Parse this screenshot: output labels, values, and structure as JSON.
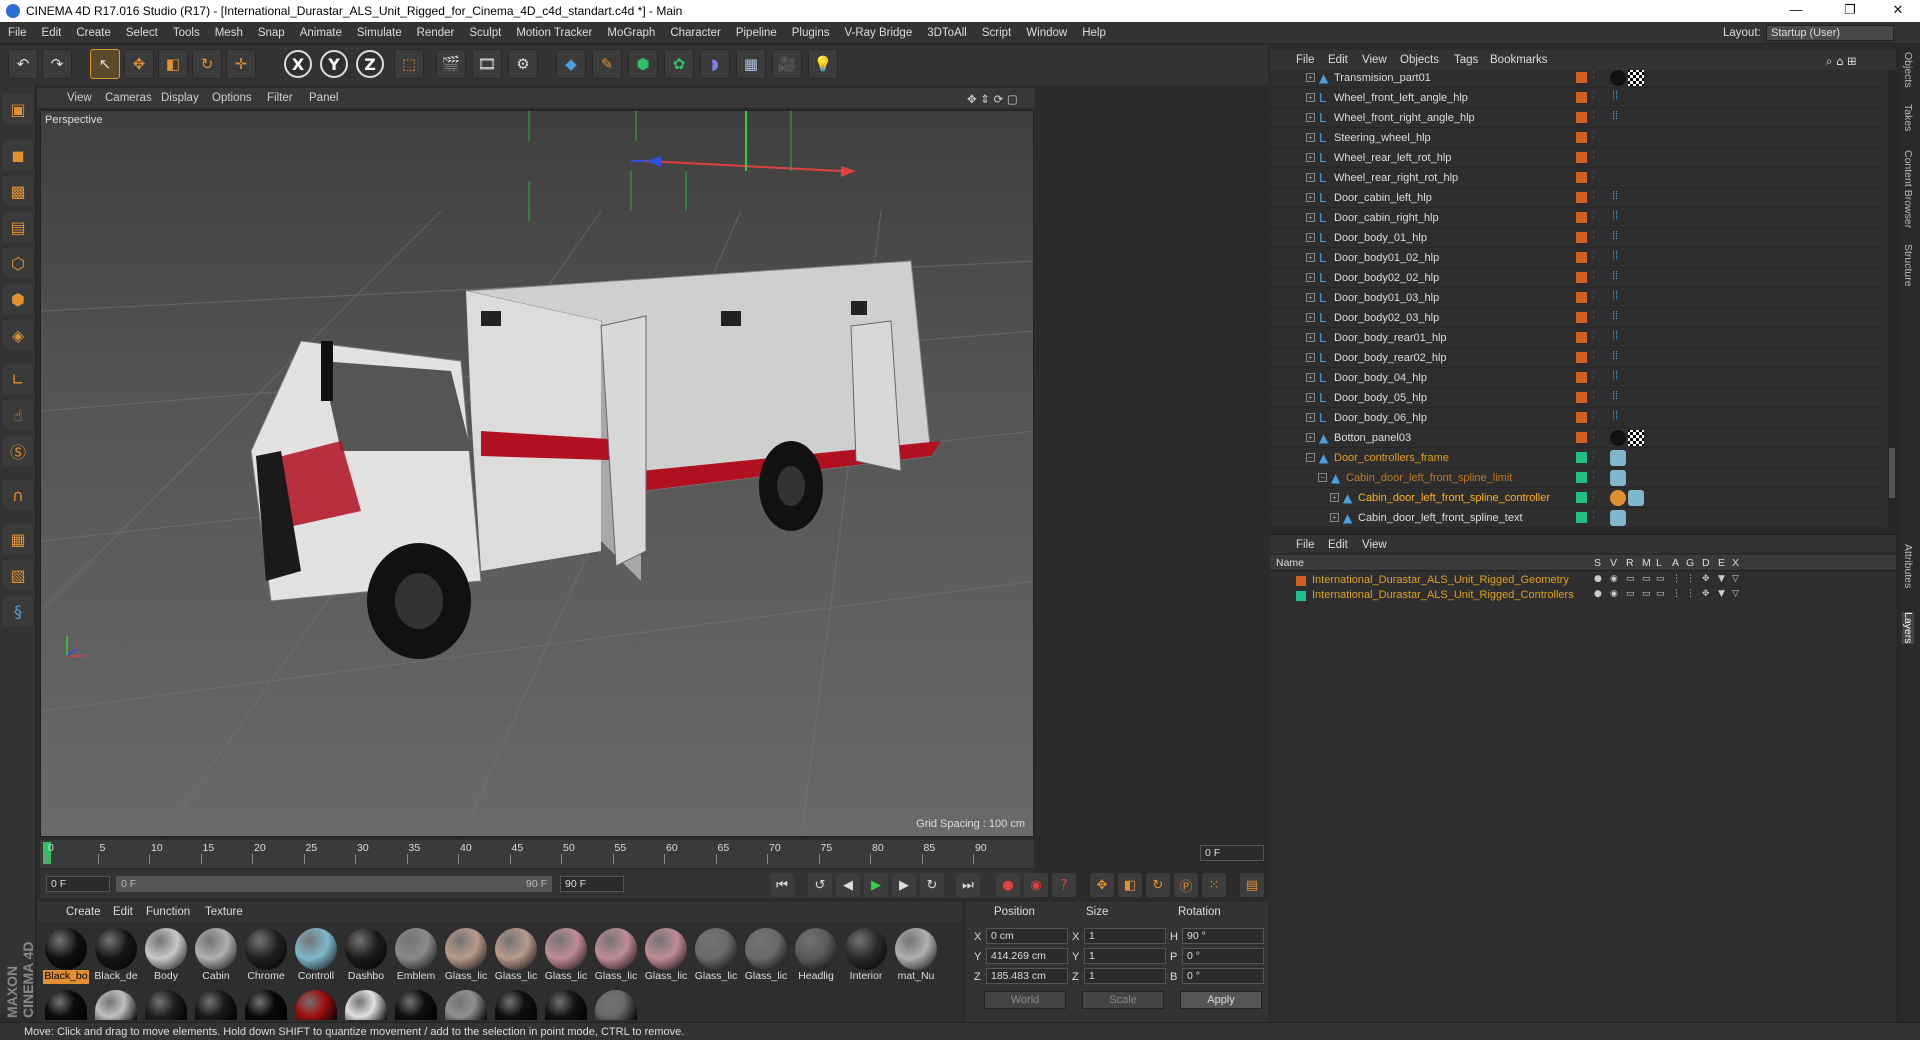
{
  "window": {
    "title": "CINEMA 4D R17.016 Studio (R17) - [International_Durastar_ALS_Unit_Rigged_for_Cinema_4D_c4d_standart.c4d *] - Main",
    "controls": [
      "—",
      "❐",
      "✕"
    ]
  },
  "menubar": {
    "items": [
      "File",
      "Edit",
      "Create",
      "Select",
      "Tools",
      "Mesh",
      "Snap",
      "Animate",
      "Simulate",
      "Render",
      "Sculpt",
      "Motion Tracker",
      "MoGraph",
      "Character",
      "Pipeline",
      "Plugins",
      "V-Ray Bridge",
      "3DToAll",
      "Script",
      "Window",
      "Help"
    ],
    "layout_label": "Layout:",
    "layout_value": "Startup (User)"
  },
  "viewport": {
    "menu": [
      "View",
      "Cameras",
      "Display",
      "Options",
      "Filter",
      "Panel"
    ],
    "camera_label": "Perspective",
    "grid_spacing": "Grid Spacing : 100 cm"
  },
  "timeline": {
    "ticks": [
      "0",
      "5",
      "10",
      "15",
      "20",
      "25",
      "30",
      "35",
      "40",
      "45",
      "50",
      "55",
      "60",
      "65",
      "70",
      "75",
      "80",
      "85",
      "90"
    ],
    "frame_end": "0 F"
  },
  "transport": {
    "current_frame": "0 F",
    "range_start": "0 F",
    "range_end": "90 F",
    "max_frame": "90 F"
  },
  "material_manager": {
    "menu": [
      "Create",
      "Edit",
      "Function",
      "Texture"
    ],
    "materials": [
      {
        "label": "Black_bo",
        "color": "#101010"
      },
      {
        "label": "Black_de",
        "color": "#151515"
      },
      {
        "label": "Body",
        "color": "#c8c8c8"
      },
      {
        "label": "Cabin",
        "color": "#b0b0b0"
      },
      {
        "label": "Chrome",
        "color": "#202020"
      },
      {
        "label": "Controll",
        "color": "#7fb8cc"
      },
      {
        "label": "Dashbo",
        "color": "#1a1a1a"
      },
      {
        "label": "Emblem",
        "color": "#8a8a8a"
      },
      {
        "label": "Glass_lic",
        "color": "#b89a8a"
      },
      {
        "label": "Glass_lic",
        "color": "#b89a8a"
      },
      {
        "label": "Glass_lic",
        "color": "#c08c96"
      },
      {
        "label": "Glass_lic",
        "color": "#c08c96"
      },
      {
        "label": "Glass_lic",
        "color": "#c08c96"
      },
      {
        "label": "Glass_lic",
        "color": "#6a6a6a"
      },
      {
        "label": "Glass_lic",
        "color": "#6a6a6a"
      },
      {
        "label": "Headlig",
        "color": "#5a5a5a"
      },
      {
        "label": "Interior",
        "color": "#2a2a2a"
      },
      {
        "label": "mat_Nu",
        "color": "#b0b0b0"
      }
    ],
    "second_row_colors": [
      "#0c0c0c",
      "#c0c0c0",
      "#202020",
      "#1a1a1a",
      "#0a0a0a",
      "#a01010",
      "#e0e0e0",
      "#101010",
      "#909090",
      "#101010",
      "#151515",
      "#6a6a6a"
    ]
  },
  "coordinates": {
    "headers": [
      "Position",
      "Size",
      "Rotation"
    ],
    "rows": [
      {
        "axis": "X",
        "pos": "0 cm",
        "size_axis": "X",
        "size": "1",
        "rot_axis": "H",
        "rot": "90 °"
      },
      {
        "axis": "Y",
        "pos": "414.269 cm",
        "size_axis": "Y",
        "size": "1",
        "rot_axis": "P",
        "rot": "0 °"
      },
      {
        "axis": "Z",
        "pos": "185.483 cm",
        "size_axis": "Z",
        "size": "1",
        "rot_axis": "B",
        "rot": "0 °"
      }
    ],
    "mode": "World",
    "size_mode": "Scale",
    "apply": "Apply"
  },
  "object_manager": {
    "menu": [
      "File",
      "Edit",
      "View",
      "Objects",
      "Tags",
      "Bookmarks"
    ],
    "rows": [
      {
        "name": "Transmision_part01",
        "style": "normal",
        "indent": 1,
        "box": "#d06020",
        "tags": "mat"
      },
      {
        "name": "Wheel_front_left_angle_hlp",
        "style": "normal",
        "indent": 1,
        "box": "#d06020",
        "tags": "dots"
      },
      {
        "name": "Wheel_front_right_angle_hlp",
        "style": "normal",
        "indent": 1,
        "box": "#d06020",
        "tags": "dots"
      },
      {
        "name": "Steering_wheel_hlp",
        "style": "normal",
        "indent": 1,
        "box": "#d06020",
        "tags": "none"
      },
      {
        "name": "Wheel_rear_left_rot_hlp",
        "style": "normal",
        "indent": 1,
        "box": "#d06020",
        "tags": "none"
      },
      {
        "name": "Wheel_rear_right_rot_hlp",
        "style": "normal",
        "indent": 1,
        "box": "#d06020",
        "tags": "none"
      },
      {
        "name": "Door_cabin_left_hlp",
        "style": "normal",
        "indent": 1,
        "box": "#d06020",
        "tags": "dots"
      },
      {
        "name": "Door_cabin_right_hlp",
        "style": "normal",
        "indent": 1,
        "box": "#d06020",
        "tags": "dots"
      },
      {
        "name": "Door_body_01_hlp",
        "style": "normal",
        "indent": 1,
        "box": "#d06020",
        "tags": "dots"
      },
      {
        "name": "Door_body01_02_hlp",
        "style": "normal",
        "indent": 1,
        "box": "#d06020",
        "tags": "dots"
      },
      {
        "name": "Door_body02_02_hlp",
        "style": "normal",
        "indent": 1,
        "box": "#d06020",
        "tags": "dots"
      },
      {
        "name": "Door_body01_03_hlp",
        "style": "normal",
        "indent": 1,
        "box": "#d06020",
        "tags": "dots"
      },
      {
        "name": "Door_body02_03_hlp",
        "style": "normal",
        "indent": 1,
        "box": "#d06020",
        "tags": "dots"
      },
      {
        "name": "Door_body_rear01_hlp",
        "style": "normal",
        "indent": 1,
        "box": "#d06020",
        "tags": "dots"
      },
      {
        "name": "Door_body_rear02_hlp",
        "style": "normal",
        "indent": 1,
        "box": "#d06020",
        "tags": "dots"
      },
      {
        "name": "Door_body_04_hlp",
        "style": "normal",
        "indent": 1,
        "box": "#d06020",
        "tags": "dots"
      },
      {
        "name": "Door_body_05_hlp",
        "style": "normal",
        "indent": 1,
        "box": "#d06020",
        "tags": "dots"
      },
      {
        "name": "Door_body_06_hlp",
        "style": "normal",
        "indent": 1,
        "box": "#d06020",
        "tags": "dots"
      },
      {
        "name": "Botton_panel03",
        "style": "normal",
        "indent": 1,
        "box": "#d06020",
        "tags": "mat"
      },
      {
        "name": "Door_controllers_frame",
        "style": "orange",
        "indent": 1,
        "box": "#20c080",
        "tags": "ctrl"
      },
      {
        "name": "Cabin_door_left_front_spline_limit",
        "style": "dim",
        "indent": 2,
        "box": "#20c080",
        "tags": "ctrl"
      },
      {
        "name": "Cabin_door_left_front_spline_controller",
        "style": "hl",
        "indent": 3,
        "box": "#20c080",
        "tags": "ctrl2"
      },
      {
        "name": "Cabin_door_left_front_spline_text",
        "style": "normal",
        "indent": 3,
        "box": "#20c080",
        "tags": "ctrl"
      }
    ]
  },
  "layer_manager": {
    "menu": [
      "File",
      "Edit",
      "View"
    ],
    "columns": [
      "Name",
      "S",
      "V",
      "R",
      "M",
      "L",
      "A",
      "G",
      "D",
      "E",
      "X"
    ],
    "layers": [
      {
        "name": "International_Durastar_ALS_Unit_Rigged_Geometry",
        "color": "#d06020"
      },
      {
        "name": "International_Durastar_ALS_Unit_Rigged_Controllers",
        "color": "#20c090"
      }
    ]
  },
  "right_tabs": [
    "Objects",
    "Takes",
    "Content Browser",
    "Structure",
    "Attributes",
    "Layers"
  ],
  "status": "Move: Click and drag to move elements. Hold down SHIFT to quantize movement / add to the selection in point mode, CTRL to remove.",
  "brand": "MAXON CINEMA 4D"
}
